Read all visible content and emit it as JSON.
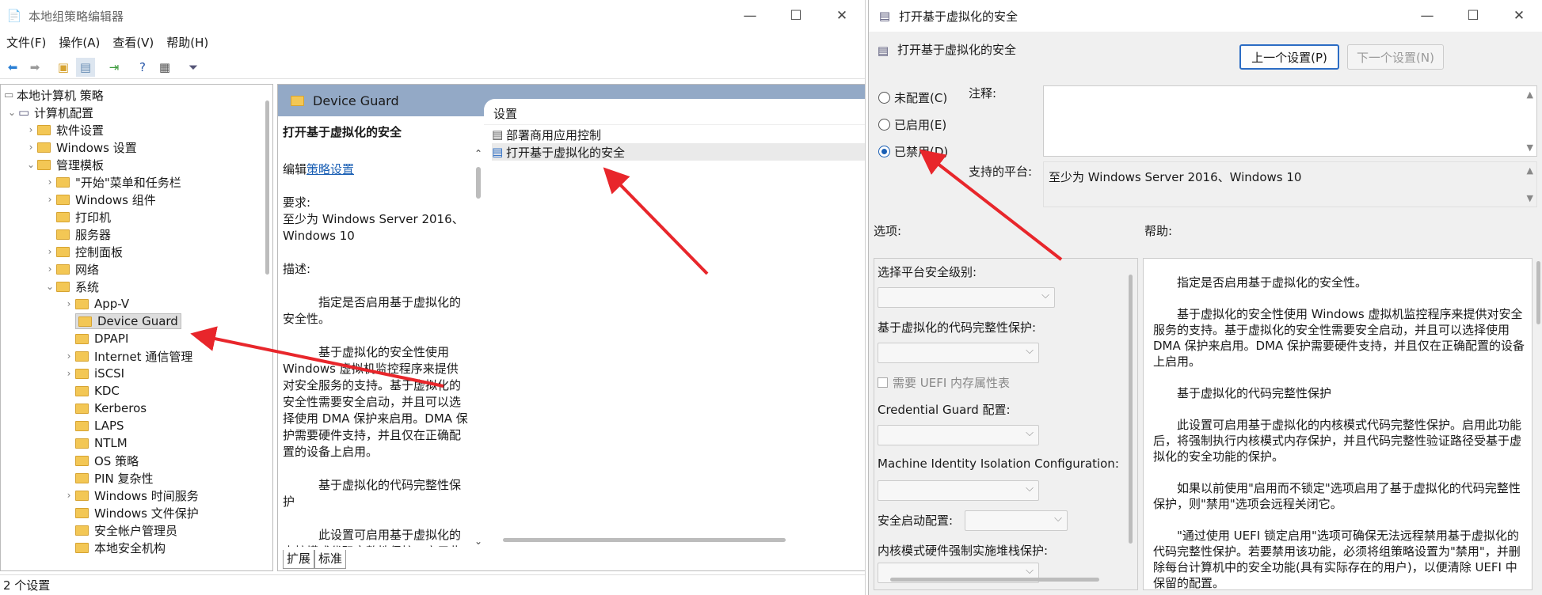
{
  "gpe": {
    "title": "本地组策略编辑器",
    "menu": [
      "文件(F)",
      "操作(A)",
      "查看(V)",
      "帮助(H)"
    ],
    "tree": {
      "root": "本地计算机 策略",
      "computer": "计算机配置",
      "software": "软件设置",
      "windows": "Windows 设置",
      "admin": "管理模板",
      "items": [
        "\"开始\"菜单和任务栏",
        "Windows 组件",
        "打印机",
        "服务器",
        "控制面板",
        "网络",
        "系统"
      ],
      "system_items": [
        "App-V",
        "Device Guard",
        "DPAPI",
        "Internet 通信管理",
        "iSCSI",
        "KDC",
        "Kerberos",
        "LAPS",
        "NTLM",
        "OS 策略",
        "PIN 复杂性",
        "Windows 时间服务",
        "Windows 文件保护",
        "安全帐户管理员",
        "本地安全机构"
      ]
    },
    "header": "Device Guard",
    "ext": {
      "title": "打开基于虚拟化的安全",
      "edit_prefix": "编辑",
      "edit_link": "策略设置",
      "req_label": "要求:",
      "req": "至少为 Windows Server 2016、Windows 10",
      "desc_label": "描述:",
      "d1": "指定是否启用基于虚拟化的安全性。",
      "d2": "基于虚拟化的安全性使用 Windows 虚拟机监控程序来提供对安全服务的支持。基于虚拟化的安全性需要安全启动，并且可以选择使用 DMA 保护来启用。DMA 保护需要硬件支持，并且仅在正确配置的设备上启用。",
      "d3": "基于虚拟化的代码完整性保护",
      "d4": "此设置可启用基于虚拟化的内核模式代码完整性保护。启用此"
    },
    "list": {
      "header": "设置",
      "rows": [
        "部署商用应用控制",
        "打开基于虚拟化的安全"
      ]
    },
    "tabs": [
      "扩展",
      "标准"
    ],
    "status": "2 个设置"
  },
  "dlg": {
    "title": "打开基于虚拟化的安全",
    "subtitle": "打开基于虚拟化的安全",
    "prev": "上一个设置(P)",
    "next": "下一个设置(N)",
    "radios": [
      "未配置(C)",
      "已启用(E)",
      "已禁用(D)"
    ],
    "selected": 2,
    "comment_label": "注释:",
    "platform_label": "支持的平台:",
    "platform": "至少为 Windows Server 2016、Windows 10",
    "options_label": "选项:",
    "help_label": "帮助:",
    "options": {
      "o1": "选择平台安全级别:",
      "o2": "基于虚拟化的代码完整性保护:",
      "uefi": "需要 UEFI 内存属性表",
      "o3": "Credential Guard 配置:",
      "o4": "Machine Identity Isolation Configuration:",
      "o5": "安全启动配置:",
      "o6": "内核模式硬件强制实施堆栈保护:"
    },
    "help": [
      "指定是否启用基于虚拟化的安全性。",
      "基于虚拟化的安全性使用 Windows 虚拟机监控程序来提供对安全服务的支持。基于虚拟化的安全性需要安全启动，并且可以选择使用 DMA 保护来启用。DMA 保护需要硬件支持，并且仅在正确配置的设备上启用。",
      "基于虚拟化的代码完整性保护",
      "此设置可启用基于虚拟化的内核模式代码完整性保护。启用此功能后，将强制执行内核模式内存保护，并且代码完整性验证路径受基于虚拟化的安全功能的保护。",
      "如果以前使用\"启用而不锁定\"选项启用了基于虚拟化的代码完整性保护，则\"禁用\"选项会远程关闭它。",
      "\"通过使用 UEFI 锁定启用\"选项可确保无法远程禁用基于虚拟化的代码完整性保护。若要禁用该功能，必须将组策略设置为\"禁用\"，并删除每台计算机中的安全功能(具有实际存在的用户)，以便清除 UEFI 中保留的配置。"
    ]
  },
  "colors": {
    "arrow": "#e8262b",
    "header": "#93a9c6",
    "selected_radio": "#1a5fb4"
  }
}
